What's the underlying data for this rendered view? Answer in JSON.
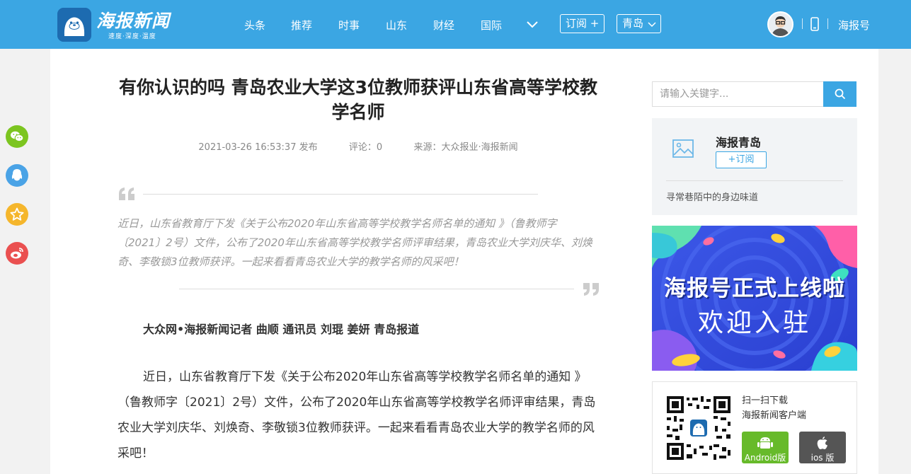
{
  "header": {
    "brand": "海报新闻",
    "slogan": "速度·深度·温度",
    "nav": [
      {
        "label": "头条"
      },
      {
        "label": "推荐"
      },
      {
        "label": "时事"
      },
      {
        "label": "山东"
      },
      {
        "label": "财经"
      },
      {
        "label": "国际"
      }
    ],
    "subscribe_label": "订阅 +",
    "city_label": "青岛",
    "haibao_label": "海报号"
  },
  "article": {
    "title": "有你认识的吗 青岛农业大学这3位教师获评山东省高等学校教学名师",
    "time": "2021-03-26 16:53:37 发布",
    "comments": "评论：0",
    "source": "来源：大众报业·海报新闻",
    "summary": "近日，山东省教育厅下发《关于公布2020年山东省高等学校教学名师名单的通知 》（鲁教师字〔2021〕2号）文件，公布了2020年山东省高等学校教学名师评审结果，青岛农业大学刘庆华、刘焕奇、李敬锁3位教师获评。一起来看看青岛农业大学的教学名师的风采吧！",
    "byline": "大众网•海报新闻记者 曲顺 通讯员 刘琨 姜妍 青岛报道",
    "paragraph": "近日，山东省教育厅下发《关于公布2020年山东省高等学校教学名师名单的通知 》（鲁教师字〔2021〕2号）文件，公布了2020年山东省高等学校教学名师评审结果，青岛农业大学刘庆华、刘焕奇、李敬锁3位教师获评。一起来看看青岛农业大学的教学名师的风采吧！"
  },
  "sidebar": {
    "search_placeholder": "请输入关键字...",
    "card": {
      "name": "海报青岛",
      "subscribe_label": "+订阅",
      "desc": "寻常巷陌中的身边味道"
    },
    "banner": {
      "line1": "海报号正式上线啦",
      "line2": "欢迎入驻"
    },
    "download": {
      "line1": "扫一扫下载",
      "line2": "海报新闻客户端",
      "android_label": "Android版",
      "ios_label": "ios 版"
    }
  },
  "colors": {
    "brand_blue": "#3ba6e3",
    "android_green": "#67ba2a",
    "wechat_green": "#7cc520",
    "qq_blue": "#4aa3e6",
    "qzone_yellow": "#f5b62c",
    "weibo_red": "#ea5050"
  },
  "icons": [
    "wechat-icon",
    "qq-icon",
    "qzone-icon",
    "weibo-icon",
    "search-icon",
    "phone-icon",
    "chevron-down-icon",
    "image-placeholder-icon",
    "android-icon",
    "apple-icon",
    "quote-open-icon",
    "quote-close-icon"
  ]
}
